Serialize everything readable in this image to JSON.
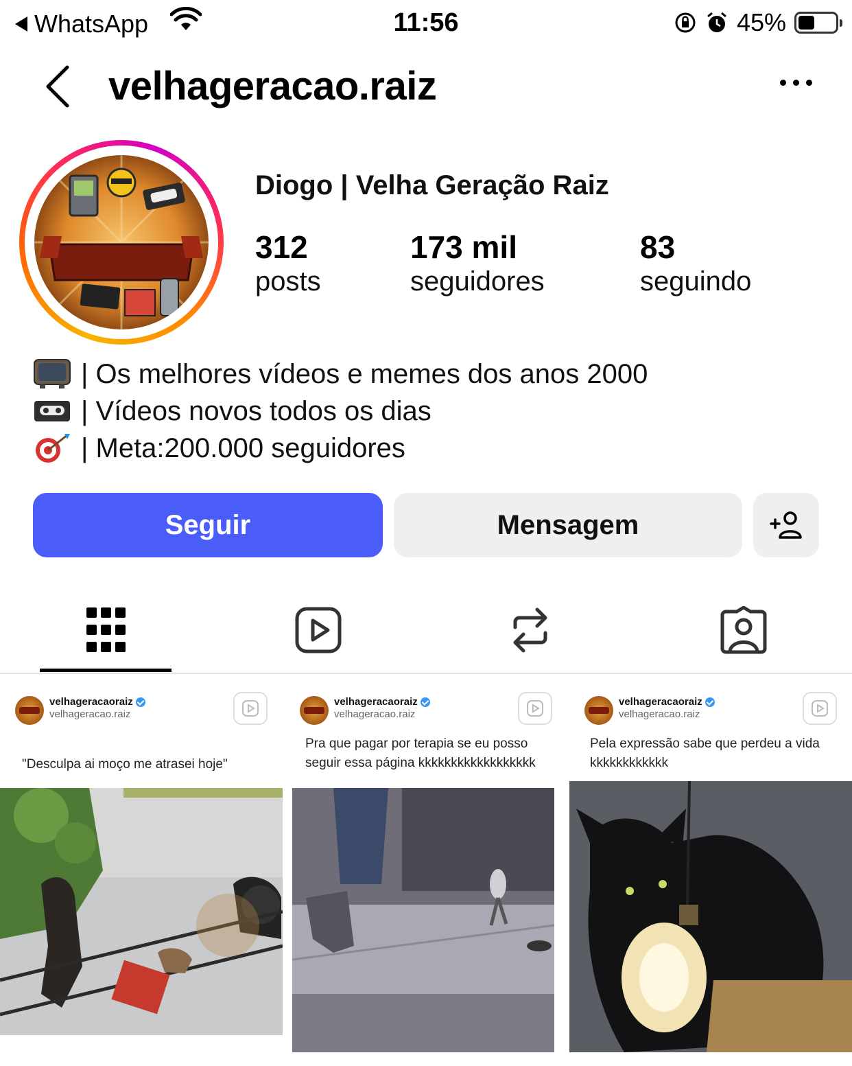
{
  "status_bar": {
    "back_app": "WhatsApp",
    "time": "11:56",
    "battery": "45%",
    "battery_level": 0.45
  },
  "header": {
    "username": "velhageracao.raiz"
  },
  "profile": {
    "display_name": "Diogo | Velha Geração Raiz",
    "stats": [
      {
        "value": "312",
        "label": "posts"
      },
      {
        "value": "173 mil",
        "label": "seguidores"
      },
      {
        "value": "83",
        "label": "seguindo"
      }
    ],
    "bio": [
      {
        "icon": "tv-icon",
        "text": "| Os melhores vídeos e memes dos anos 2000"
      },
      {
        "icon": "videocassette-icon",
        "text": "| Vídeos novos todos os dias"
      },
      {
        "icon": "target-icon",
        "text": "| Meta:200.000 seguidores"
      }
    ]
  },
  "actions": {
    "follow_label": "Seguir",
    "message_label": "Mensagem"
  },
  "tabs": [
    "grid-icon",
    "reels-icon",
    "reposts-icon",
    "tagged-icon"
  ],
  "posts": [
    {
      "user": "velhageracaoraiz",
      "handle": "velhageracao.raiz",
      "caption": "\"Desculpa ai moço me atrasei hoje\""
    },
    {
      "user": "velhageracaoraiz",
      "handle": "velhageracao.raiz",
      "caption": "Pra que pagar por terapia se eu posso seguir essa página kkkkkkkkkkkkkkkkkk"
    },
    {
      "user": "velhageracaoraiz",
      "handle": "velhageracao.raiz",
      "caption": "Pela expressão sabe que perdeu a vida kkkkkkkkkkkk"
    }
  ],
  "colors": {
    "follow_button": "#4a5df9",
    "secondary_button": "#efeff2",
    "verified": "#3897f0"
  }
}
